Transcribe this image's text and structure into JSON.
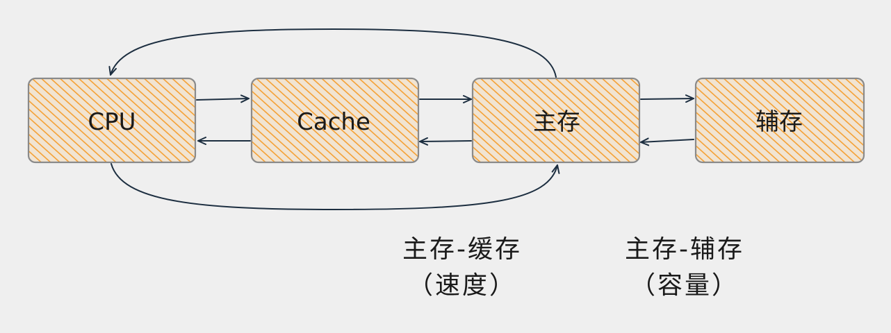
{
  "nodes": {
    "cpu": "CPU",
    "cache": "Cache",
    "main_memory": "主存",
    "secondary_storage": "辅存"
  },
  "captions": {
    "main_cache": {
      "line1": "主存-缓存",
      "line2": "（速度）"
    },
    "main_secondary": {
      "line1": "主存-辅存",
      "line2": "（容量）"
    }
  },
  "colors": {
    "background": "#efefef",
    "box_fill": "#f5a033",
    "box_stroke": "#8a8a8a",
    "arrow": "#1c2e40"
  }
}
